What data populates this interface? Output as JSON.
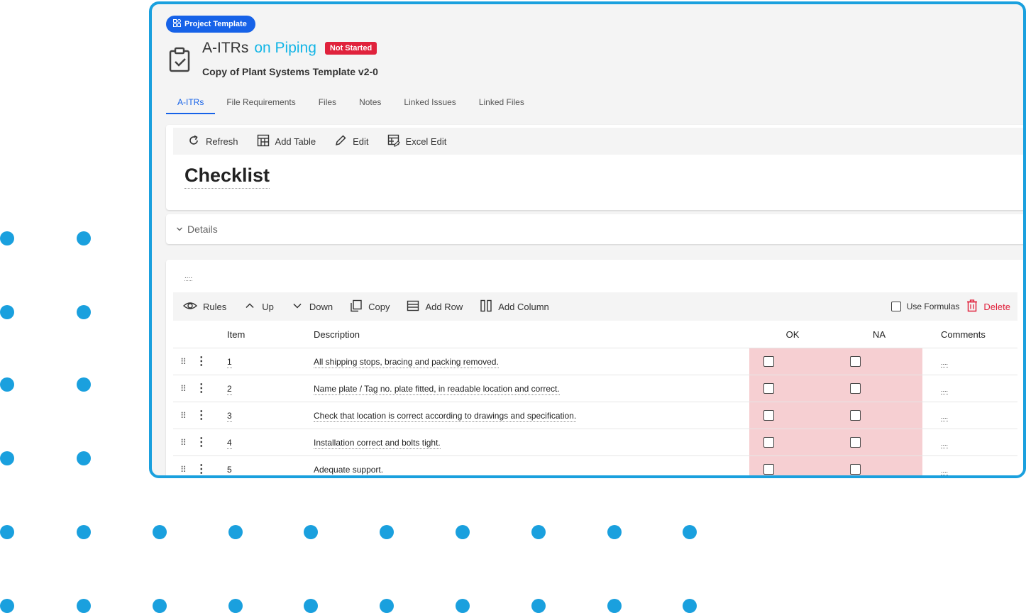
{
  "header": {
    "chip_label": "Project Template",
    "title": "A-ITRs",
    "title_suffix": "on Piping",
    "status": "Not Started",
    "subtitle": "Copy of Plant Systems Template v2-0"
  },
  "tabs": [
    "A-ITRs",
    "File Requirements",
    "Files",
    "Notes",
    "Linked Issues",
    "Linked Files"
  ],
  "toolbar": {
    "refresh": "Refresh",
    "add_table": "Add Table",
    "edit": "Edit",
    "excel_edit": "Excel Edit"
  },
  "checklist_title": "Checklist",
  "details_label": "Details",
  "table_name_placeholder": "....",
  "table_toolbar": {
    "rules": "Rules",
    "up": "Up",
    "down": "Down",
    "copy": "Copy",
    "add_row": "Add Row",
    "add_column": "Add Column",
    "use_formulas": "Use Formulas",
    "delete": "Delete"
  },
  "table": {
    "columns": [
      "Item",
      "Description",
      "OK",
      "NA",
      "Comments"
    ],
    "rows": [
      {
        "item": "1",
        "description": "All shipping stops, bracing and packing removed.",
        "comment": "...."
      },
      {
        "item": "2",
        "description": "Name plate / Tag no. plate fitted, in readable location and correct.",
        "comment": "...."
      },
      {
        "item": "3",
        "description": "Check that location is correct according to drawings and specification.",
        "comment": "...."
      },
      {
        "item": "4",
        "description": "Installation correct and bolts tight.",
        "comment": "...."
      },
      {
        "item": "5",
        "description": "Adequate support.",
        "comment": "...."
      }
    ]
  },
  "colors": {
    "accent_blue": "#1662e8",
    "cyan": "#12b5e6",
    "frame_border": "#1aa0de",
    "status_red": "#e0223c",
    "cell_pink": "#f6cfd2"
  }
}
